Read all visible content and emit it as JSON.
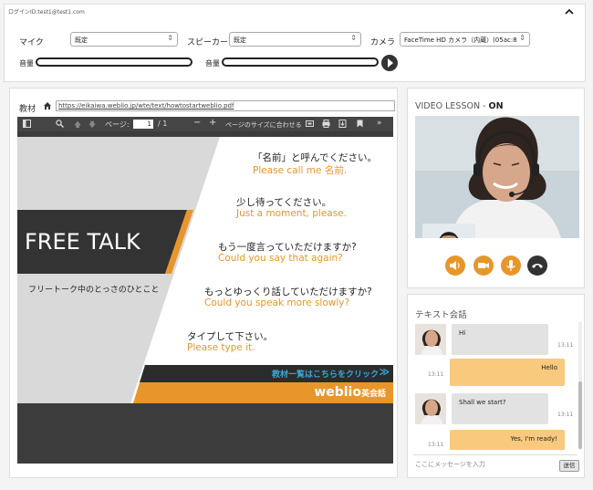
{
  "header": {
    "login_id": "ログインID:test1@test1.com",
    "collapse_icon": "chevron-up-icon"
  },
  "devices": {
    "mic_label": "マイク",
    "mic_value": "既定",
    "speaker_label": "スピーカー",
    "speaker_value": "既定",
    "camera_label": "カメラ",
    "camera_value": "FaceTime HD カメラ（内蔵）(05ac:8",
    "volume_label": "音量",
    "volume_label_2": "音量"
  },
  "material": {
    "label": "教材",
    "url": "https://eikaiwa.weblio.jp/wte/text/howtostartweblio.pdf"
  },
  "viewer": {
    "page_label": "ページ:",
    "page_current": "1",
    "page_total": "/ 1",
    "fit_label": "ページのサイズに合わせる",
    "minus": "−",
    "plus": "+"
  },
  "slide": {
    "title": "FREE TALK",
    "subtitle": "フリートーク中のとっさのひとこと",
    "phrases": [
      {
        "jp": "「名前」と呼んでください。",
        "en": "Please call me 名前."
      },
      {
        "jp": "少し待ってください。",
        "en": "Just a moment, please."
      },
      {
        "jp": "もう一度言っていただけますか?",
        "en": "Could you say that again?"
      },
      {
        "jp": "もっとゆっくり話していただけますか?",
        "en": "Could you speak more slowly?"
      },
      {
        "jp": "タイプして下さい。",
        "en": "Please type it."
      }
    ],
    "link": "教材一覧はこちらをクリック",
    "link_arrow": "≫",
    "brand": "weblio",
    "brand_sub": "英会話",
    "accent_color": "#e8962b",
    "dark_color": "#333333"
  },
  "video": {
    "title_prefix": "VIDEO LESSON - ",
    "title_status": "ON",
    "controls": [
      "speaker-icon",
      "camera-icon",
      "microphone-icon",
      "hangup-icon"
    ]
  },
  "chat": {
    "title": "テキスト会話",
    "messages": [
      {
        "from": "teacher",
        "text": "Hi",
        "time": "13:11"
      },
      {
        "from": "student",
        "text": "Hello",
        "time": "13:11"
      },
      {
        "from": "teacher",
        "text": "Shall we start?",
        "time": "13:11"
      },
      {
        "from": "student",
        "text": "Yes, I'm ready!",
        "time": "13:11"
      }
    ],
    "input_placeholder": "ここにメッセージを入力",
    "send_label": "送信"
  }
}
